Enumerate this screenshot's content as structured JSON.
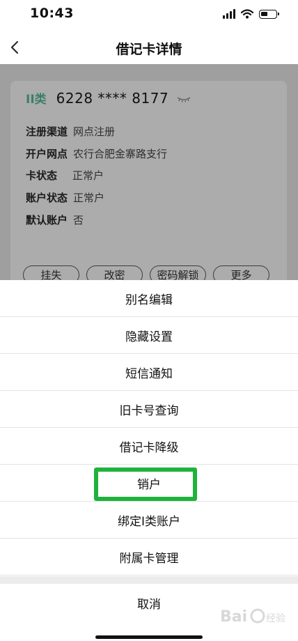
{
  "status_bar": {
    "time": "10:43"
  },
  "nav": {
    "title": "借记卡详情"
  },
  "card": {
    "type_label": "II类",
    "number": "6228 **** 8177",
    "fields": [
      {
        "key": "注册渠道",
        "value": "网点注册"
      },
      {
        "key": "开户网点",
        "value": "农行合肥金寨路支行"
      },
      {
        "key": "卡状态",
        "value": "正常户"
      },
      {
        "key": "账户状态",
        "value": "正常户"
      },
      {
        "key": "默认账户",
        "value": "否"
      }
    ],
    "actions": [
      "挂失",
      "改密",
      "密码解锁",
      "更多"
    ]
  },
  "action_sheet": {
    "items": [
      "别名编辑",
      "隐藏设置",
      "短信通知",
      "旧卡号查询",
      "借记卡降级",
      "销户",
      "绑定I类账户",
      "附属卡管理"
    ],
    "cancel": "取消",
    "highlight_color": "#1eb33b"
  },
  "watermark": {
    "text": "Bai 经验"
  }
}
